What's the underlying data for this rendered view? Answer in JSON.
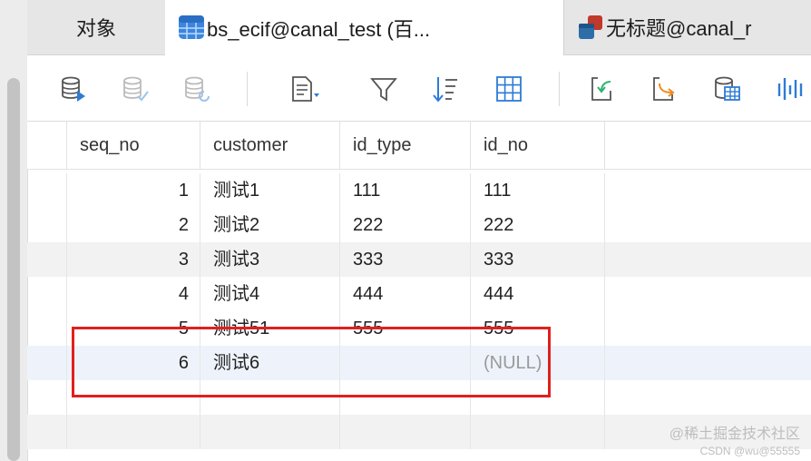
{
  "tabs": [
    {
      "label": "对象"
    },
    {
      "label": "bs_ecif@canal_test (百..."
    },
    {
      "label": "无标题@canal_r"
    }
  ],
  "grid": {
    "columns": [
      "seq_no",
      "customer",
      "id_type",
      "id_no"
    ],
    "rows": [
      {
        "seq_no": "1",
        "customer": "测试1",
        "id_type": "111",
        "id_no": "111"
      },
      {
        "seq_no": "2",
        "customer": "测试2",
        "id_type": "222",
        "id_no": "222"
      },
      {
        "seq_no": "3",
        "customer": "测试3",
        "id_type": "333",
        "id_no": "333"
      },
      {
        "seq_no": "4",
        "customer": "测试4",
        "id_type": "444",
        "id_no": "444"
      },
      {
        "seq_no": "5",
        "customer": "测试51",
        "id_type": "555",
        "id_no": "555"
      },
      {
        "seq_no": "6",
        "customer": "测试6",
        "id_type": "",
        "id_no": "(NULL)"
      }
    ]
  },
  "watermark": {
    "line1": "@稀土掘金技术社区",
    "line2": "CSDN @wu@55555"
  },
  "colors": {
    "highlight": "#e0201e",
    "accent_blue": "#2e7bd6",
    "accent_orange": "#f08a1c"
  }
}
